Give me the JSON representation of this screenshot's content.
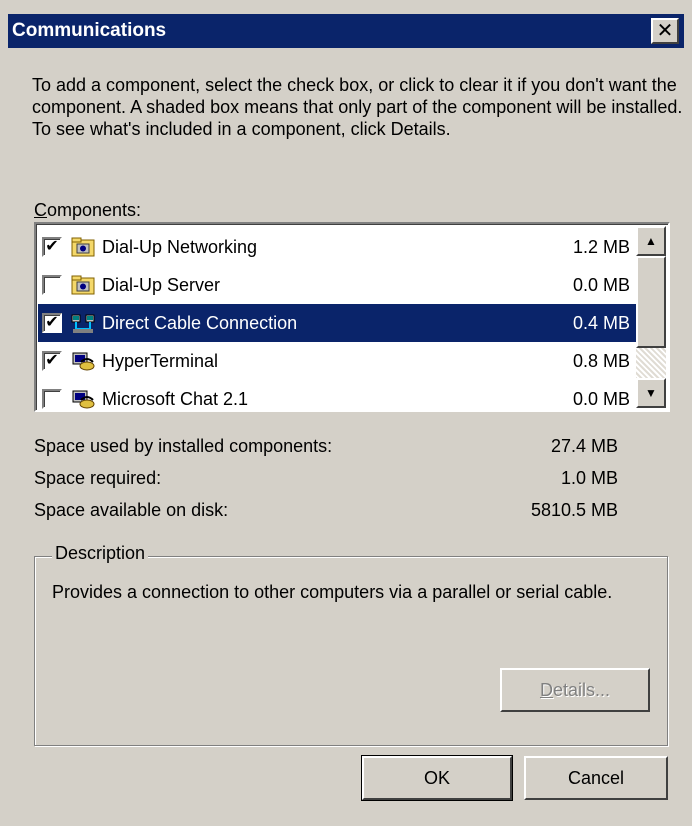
{
  "window": {
    "title": "Communications",
    "close_glyph": "✕"
  },
  "intro_text": "To add a component, select the check box, or click to clear it if you don't want the component. A shaded box means that only part of the component will be installed. To see what's included in a component, click Details.",
  "components_label": {
    "accel": "C",
    "rest": "omponents:"
  },
  "components": [
    {
      "label": "Dial-Up Networking",
      "size": "1.2 MB",
      "checked": true,
      "icon": "dialup-folder-icon"
    },
    {
      "label": "Dial-Up Server",
      "size": "0.0 MB",
      "checked": false,
      "icon": "dialup-folder-icon"
    },
    {
      "label": "Direct Cable Connection",
      "size": "0.4 MB",
      "checked": true,
      "icon": "cable-connection-icon",
      "selected": true
    },
    {
      "label": "HyperTerminal",
      "size": "0.8 MB",
      "checked": true,
      "icon": "phone-terminal-icon"
    },
    {
      "label": "Microsoft Chat 2.1",
      "size": "0.0 MB",
      "checked": false,
      "icon": "phone-terminal-icon"
    }
  ],
  "space": {
    "used_label": "Space used by installed components:",
    "used_value": "27.4 MB",
    "required_label": "Space required:",
    "required_value": "1.0 MB",
    "available_label": "Space available on disk:",
    "available_value": "5810.5 MB"
  },
  "description": {
    "title": "Description",
    "text": "Provides a connection to other computers via a parallel or serial cable."
  },
  "buttons": {
    "details_accel": "D",
    "details_rest": "etails...",
    "ok": "OK",
    "cancel": "Cancel"
  },
  "colors": {
    "face": "#d4d0c8",
    "title_bar": "#0a246a",
    "selection": "#0a246a"
  }
}
